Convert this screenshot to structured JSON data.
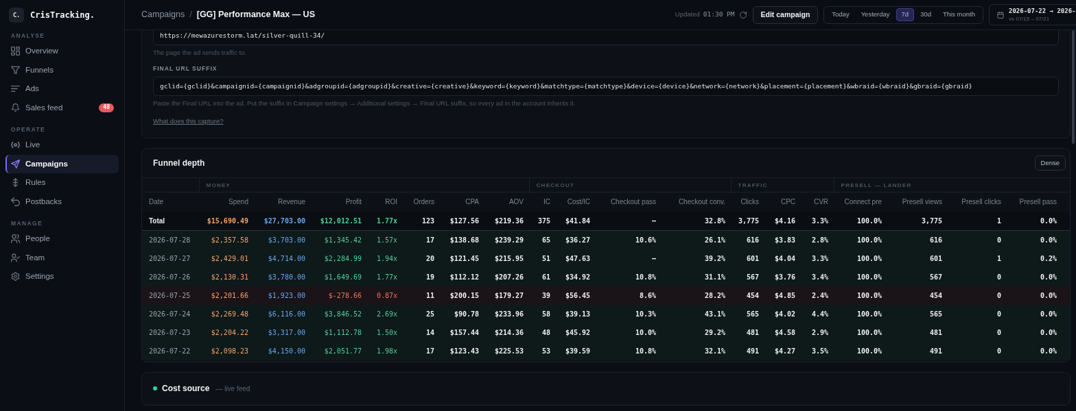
{
  "sidebar": {
    "logo_mark": "C.",
    "brand": "CrisTracking.",
    "sections": [
      {
        "label": "ANALYSE",
        "items": [
          {
            "label": "Overview",
            "selected": false
          },
          {
            "label": "Funnels",
            "selected": false
          },
          {
            "label": "Ads",
            "selected": false
          },
          {
            "label": "Sales feed",
            "selected": false,
            "badge": "48"
          }
        ]
      },
      {
        "label": "OPERATE",
        "items": [
          {
            "label": "Live",
            "selected": false
          },
          {
            "label": "Campaigns",
            "selected": true
          },
          {
            "label": "Rules",
            "selected": false
          },
          {
            "label": "Postbacks",
            "selected": false
          }
        ]
      },
      {
        "label": "MANAGE",
        "items": [
          {
            "label": "People",
            "selected": false
          },
          {
            "label": "Team",
            "selected": false
          },
          {
            "label": "Settings",
            "selected": false
          }
        ]
      }
    ]
  },
  "header": {
    "breadcrumb": {
      "parent": "Campaigns",
      "separator": "/",
      "current": "[GG] Performance Max — US"
    },
    "updated": {
      "label": "Updated",
      "time": "01:30 PM"
    },
    "edit_button": "Edit campaign",
    "ranges": [
      {
        "label": "Today",
        "selected": false
      },
      {
        "label": "Yesterday",
        "selected": false
      },
      {
        "label": "7d",
        "selected": true
      },
      {
        "label": "30d",
        "selected": false
      },
      {
        "label": "This month",
        "selected": false
      }
    ],
    "date_range": {
      "value": "2026-07-22 → 2026-",
      "compare": "vs 07/15 – 07/21"
    }
  },
  "tracking": {
    "url_value": "https://mewazurestorm.lat/silver-quill-34/",
    "url_help": "The page the ad sends traffic to.",
    "suffix_label": "FINAL URL SUFFIX",
    "suffix_value": "gclid={gclid}&campaignid={campaignid}&adgroupid={adgroupid}&creative={creative}&keyword={keyword}&matchtype={matchtype}&device={device}&network={network}&placement={placement}&wbraid={wbraid}&gbraid={gbraid}",
    "suffix_help": "Paste the Final URL into the ad. Put the suffix in Campaign settings → Additional settings → Final URL suffix, so every ad in the account inherits it.",
    "link": "What does this capture?"
  },
  "funnel": {
    "title": "Funnel depth",
    "dense_button": "Dense",
    "table": {
      "date_column": "Date",
      "groups": [
        {
          "label": "MONEY",
          "columns": [
            {
              "label": "Spend",
              "kind": "cost"
            },
            {
              "label": "Revenue",
              "kind": "revenue"
            },
            {
              "label": "Profit",
              "kind": "profit"
            },
            {
              "label": "ROI",
              "kind": "profit"
            },
            {
              "label": "Orders",
              "kind": "number"
            },
            {
              "label": "CPA",
              "kind": "number"
            },
            {
              "label": "AOV",
              "kind": "number"
            }
          ]
        },
        {
          "label": "CHECKOUT",
          "columns": [
            {
              "label": "IC",
              "kind": "number"
            },
            {
              "label": "Cost/IC",
              "kind": "number"
            },
            {
              "label": "Checkout pass",
              "kind": "number"
            },
            {
              "label": "Checkout conv.",
              "kind": "number"
            }
          ]
        },
        {
          "label": "TRAFFIC",
          "columns": [
            {
              "label": "Clicks",
              "kind": "number"
            },
            {
              "label": "CPC",
              "kind": "number"
            },
            {
              "label": "CVR",
              "kind": "number"
            }
          ]
        },
        {
          "label": "PRESELL — LANDER",
          "columns": [
            {
              "label": "Connect pre",
              "kind": "number"
            },
            {
              "label": "Presell views",
              "kind": "number"
            },
            {
              "label": "Presell clicks",
              "kind": "number"
            },
            {
              "label": "Presell pass",
              "kind": "number"
            }
          ]
        }
      ],
      "total": {
        "label": "Total",
        "loss": false,
        "values": [
          "$15,690.49",
          "$27,703.00",
          "$12,012.51",
          "1.77x",
          "123",
          "$127.56",
          "$219.36",
          "375",
          "$41.84",
          "—",
          "32.8%",
          "3,775",
          "$4.16",
          "3.3%",
          "100.0%",
          "3,775",
          "1",
          "0.0%"
        ]
      },
      "rows": [
        {
          "date": "2026-07-28",
          "loss": false,
          "values": [
            "$2,357.58",
            "$3,703.00",
            "$1,345.42",
            "1.57x",
            "17",
            "$138.68",
            "$239.29",
            "65",
            "$36.27",
            "10.6%",
            "26.1%",
            "616",
            "$3.83",
            "2.8%",
            "100.0%",
            "616",
            "0",
            "0.0%"
          ]
        },
        {
          "date": "2026-07-27",
          "loss": false,
          "values": [
            "$2,429.01",
            "$4,714.00",
            "$2,284.99",
            "1.94x",
            "20",
            "$121.45",
            "$215.95",
            "51",
            "$47.63",
            "—",
            "39.2%",
            "601",
            "$4.04",
            "3.3%",
            "100.0%",
            "601",
            "1",
            "0.2%"
          ]
        },
        {
          "date": "2026-07-26",
          "loss": false,
          "values": [
            "$2,130.31",
            "$3,780.00",
            "$1,649.69",
            "1.77x",
            "19",
            "$112.12",
            "$207.26",
            "61",
            "$34.92",
            "10.8%",
            "31.1%",
            "567",
            "$3.76",
            "3.4%",
            "100.0%",
            "567",
            "0",
            "0.0%"
          ]
        },
        {
          "date": "2026-07-25",
          "loss": true,
          "values": [
            "$2,201.66",
            "$1,923.00",
            "$-278.66",
            "0.87x",
            "11",
            "$200.15",
            "$179.27",
            "39",
            "$56.45",
            "8.6%",
            "28.2%",
            "454",
            "$4.85",
            "2.4%",
            "100.0%",
            "454",
            "0",
            "0.0%"
          ]
        },
        {
          "date": "2026-07-24",
          "loss": false,
          "values": [
            "$2,269.48",
            "$6,116.00",
            "$3,846.52",
            "2.69x",
            "25",
            "$90.78",
            "$233.96",
            "58",
            "$39.13",
            "10.3%",
            "43.1%",
            "565",
            "$4.02",
            "4.4%",
            "100.0%",
            "565",
            "0",
            "0.0%"
          ]
        },
        {
          "date": "2026-07-23",
          "loss": false,
          "values": [
            "$2,204.22",
            "$3,317.00",
            "$1,112.78",
            "1.50x",
            "14",
            "$157.44",
            "$214.36",
            "48",
            "$45.92",
            "10.0%",
            "29.2%",
            "481",
            "$4.58",
            "2.9%",
            "100.0%",
            "481",
            "0",
            "0.0%"
          ]
        },
        {
          "date": "2026-07-22",
          "loss": false,
          "values": [
            "$2,098.23",
            "$4,150.00",
            "$2,051.77",
            "1.98x",
            "17",
            "$123.43",
            "$225.53",
            "53",
            "$39.59",
            "10.8%",
            "32.1%",
            "491",
            "$4.27",
            "3.5%",
            "100.0%",
            "491",
            "0",
            "0.0%"
          ]
        }
      ]
    }
  },
  "cost_source": {
    "title": "Cost source",
    "subtitle": "— live feed"
  }
}
